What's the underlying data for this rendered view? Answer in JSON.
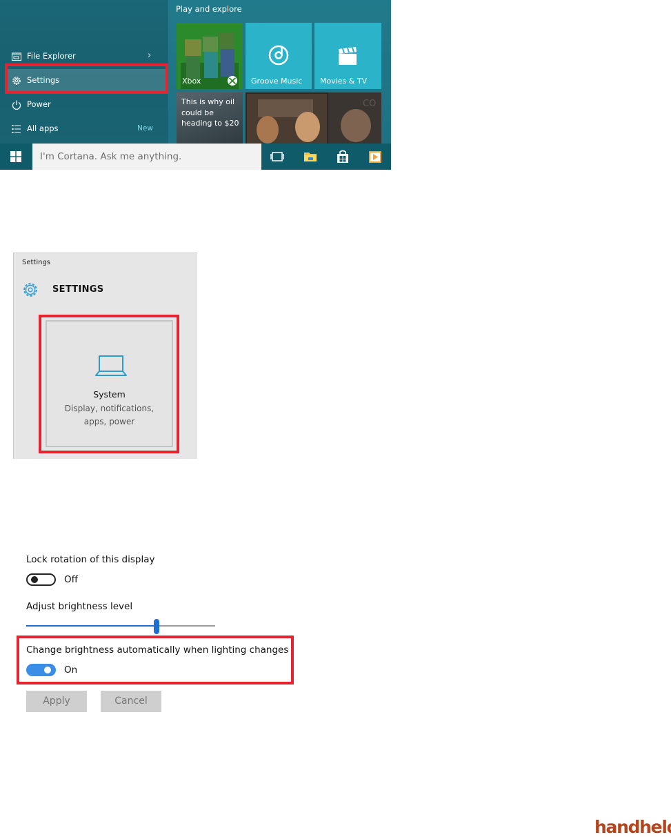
{
  "start_menu": {
    "items": [
      {
        "label": "File Explorer",
        "icon": "file-explorer-icon"
      },
      {
        "label": "Settings",
        "icon": "gear-icon"
      },
      {
        "label": "Power",
        "icon": "power-icon"
      },
      {
        "label": "All apps",
        "icon": "all-apps-icon",
        "badge": "New"
      }
    ],
    "group_title": "Play and explore",
    "tiles": [
      {
        "label": "Xbox"
      },
      {
        "label": "Groove Music"
      },
      {
        "label": "Movies & TV"
      },
      {
        "label": "This is why oil could be heading to $20"
      }
    ],
    "accent": "#1e6f7f",
    "highlight_color": "#e32431"
  },
  "taskbar": {
    "search_placeholder": "I'm Cortana. Ask me anything."
  },
  "settings_window": {
    "title": "Settings",
    "heading": "SETTINGS",
    "system_tile": {
      "title": "System",
      "description": "Display, notifications, apps, power"
    }
  },
  "display_settings": {
    "lock_rotation_label": "Lock rotation of this display",
    "lock_rotation_state": "Off",
    "brightness_label": "Adjust brightness level",
    "brightness_level": 0.69,
    "auto_brightness_label": "Change brightness automatically when lighting changes",
    "auto_brightness_state": "On",
    "apply_label": "Apply",
    "cancel_label": "Cancel",
    "toggle_on_color": "#3a8ee6"
  },
  "watermark": {
    "text": "handheld"
  }
}
